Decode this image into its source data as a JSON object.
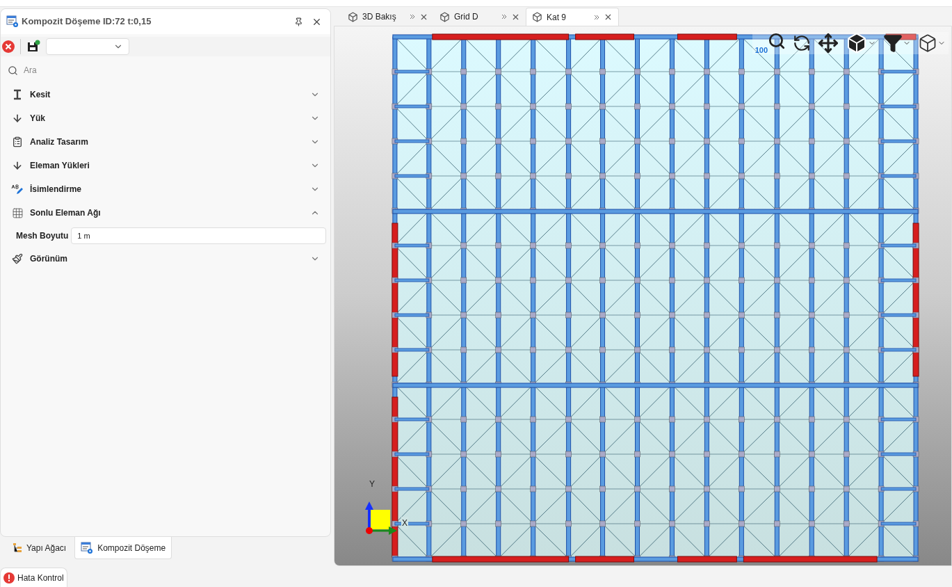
{
  "panel": {
    "title": "Kompozit Döşeme ID:72 t:0,15",
    "search": {
      "placeholder": "Ara"
    },
    "sections": [
      {
        "label": "Kesit",
        "expanded": false
      },
      {
        "label": "Yük",
        "expanded": false
      },
      {
        "label": "Analiz Tasarım",
        "expanded": false
      },
      {
        "label": "Eleman Yükleri",
        "expanded": false
      },
      {
        "label": "İsimlendirme",
        "expanded": false
      },
      {
        "label": "Sonlu Eleman Ağı",
        "expanded": true,
        "fields": [
          {
            "label": "Mesh Boyutu",
            "value": "1 m"
          }
        ]
      },
      {
        "label": "Görünüm",
        "expanded": false
      }
    ]
  },
  "panel_tabs": [
    {
      "label": "Yapı Ağacı",
      "selected": false
    },
    {
      "label": "Kompozit Döşeme",
      "selected": true
    }
  ],
  "bottom_tab": {
    "label": "Hata Kontrol"
  },
  "view_tabs": [
    {
      "label": "3D Bakış",
      "selected": false
    },
    {
      "label": "Grid D",
      "selected": false
    },
    {
      "label": "Kat 9",
      "selected": true
    }
  ],
  "viewport": {
    "zoom_label": "100",
    "axis_x": "X",
    "axis_y": "Y"
  }
}
